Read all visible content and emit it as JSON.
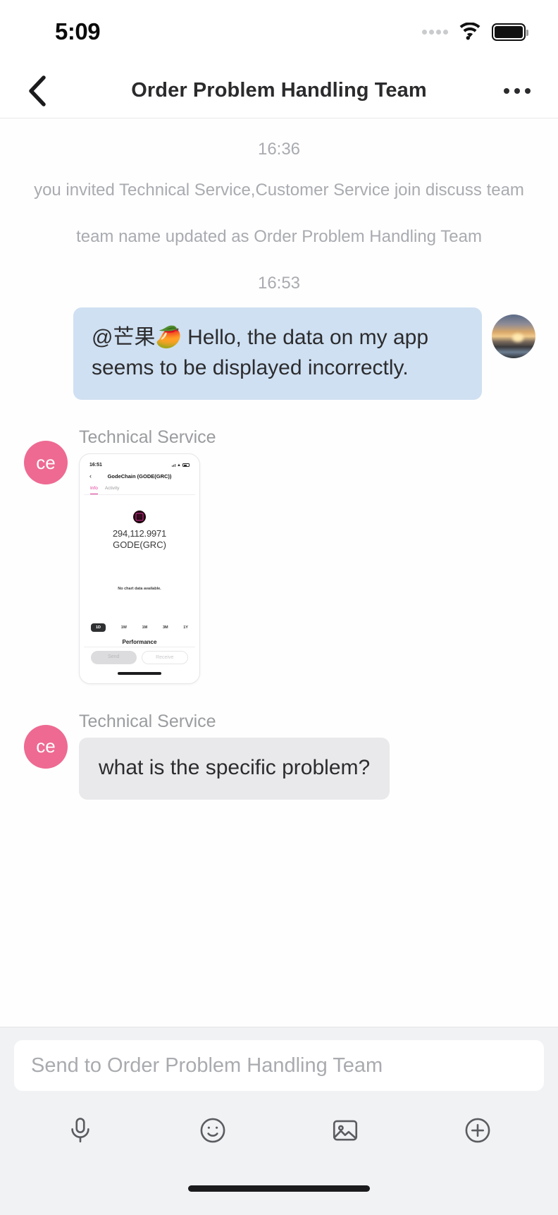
{
  "status_bar": {
    "time": "5:09",
    "signal_icon": "signal-dots-icon",
    "wifi_icon": "wifi-icon",
    "battery_icon": "battery-full-icon"
  },
  "nav": {
    "back_icon": "chevron-left-icon",
    "title": "Order Problem Handling Team",
    "more_icon": "more-horizontal-icon"
  },
  "chat": {
    "system_time_1": "16:36",
    "system_event_1": "you invited Technical Service,Customer Service join discuss team",
    "system_event_2": "team name updated as Order Problem Handling Team",
    "system_time_2": "16:53",
    "outgoing_message": "@芒果🥭 Hello, the data on my app seems to be displayed incorrectly.",
    "messages": [
      {
        "sender": "Technical Service",
        "avatar_initials": "ce",
        "type": "image"
      },
      {
        "sender": "Technical Service",
        "avatar_initials": "ce",
        "type": "text",
        "text": "what is the specific problem?"
      }
    ]
  },
  "shared_screenshot": {
    "status_time": "16:51",
    "back_icon": "chevron-left-icon",
    "title": "GodeChain (GODE(GRC))",
    "tabs": [
      {
        "label": "Info",
        "active": true
      },
      {
        "label": "Activity",
        "active": false
      }
    ],
    "balance": "294,112.9971",
    "symbol": "GODE(GRC)",
    "chart_empty_text": "No chart data available.",
    "ranges": [
      {
        "label": "1D",
        "active": true
      },
      {
        "label": "1W",
        "active": false
      },
      {
        "label": "1M",
        "active": false
      },
      {
        "label": "3M",
        "active": false
      },
      {
        "label": "1Y",
        "active": false
      }
    ],
    "performance_label": "Performance",
    "send_label": "Send",
    "receive_label": "Receive"
  },
  "composer": {
    "placeholder": "Send to Order Problem Handling Team",
    "value": "",
    "tools": [
      {
        "name": "microphone-icon"
      },
      {
        "name": "emoji-icon"
      },
      {
        "name": "image-icon"
      },
      {
        "name": "plus-icon"
      }
    ]
  },
  "colors": {
    "outgoing_bubble": "#cfe0f2",
    "incoming_bubble": "#e9e9eb",
    "avatar_pink": "#ee6a92",
    "accent_pink": "#d9338f"
  }
}
